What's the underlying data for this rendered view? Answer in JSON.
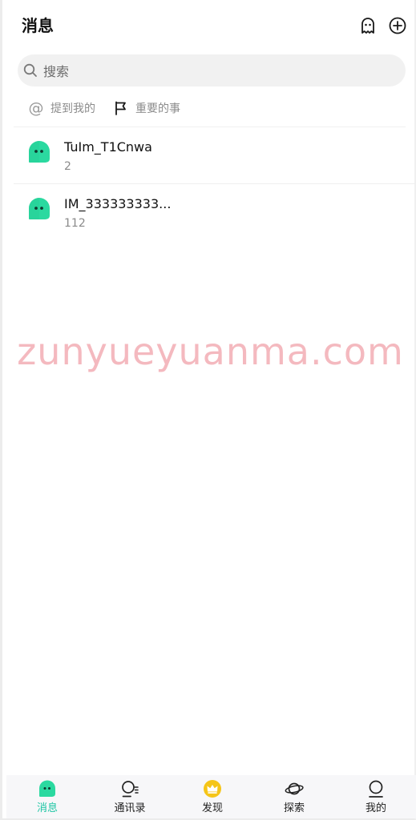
{
  "header": {
    "title": "消息",
    "buttons": [
      {
        "icon": "ghost-icon"
      },
      {
        "icon": "plus-circle-icon"
      }
    ]
  },
  "search": {
    "placeholder": "搜索",
    "value": "",
    "icon": "search-icon"
  },
  "quick_filters": [
    {
      "label": "提到我的",
      "icon": "at-icon"
    },
    {
      "label": "重要的事",
      "icon": "flag-icon"
    }
  ],
  "conversations": [
    {
      "name": "TuIm_T1Cnwa",
      "preview": "2",
      "avatar": "green-ghost-avatar"
    },
    {
      "name": "IM_333333333...",
      "preview": "112",
      "avatar": "green-ghost-avatar"
    }
  ],
  "watermark": "zunyueyuanma.com",
  "tabs": [
    {
      "label": "消息",
      "icon": "message-ghost-icon",
      "active": true
    },
    {
      "label": "通讯录",
      "icon": "contacts-icon",
      "active": false
    },
    {
      "label": "发现",
      "icon": "crown-icon",
      "active": false
    },
    {
      "label": "探索",
      "icon": "planet-icon",
      "active": false
    },
    {
      "label": "我的",
      "icon": "profile-icon",
      "active": false
    }
  ],
  "colors": {
    "accent": "#1ec6a4",
    "avatar_green": "#2bd9a0",
    "crown_gold": "#f5c518",
    "watermark": "#f4b9bf"
  }
}
